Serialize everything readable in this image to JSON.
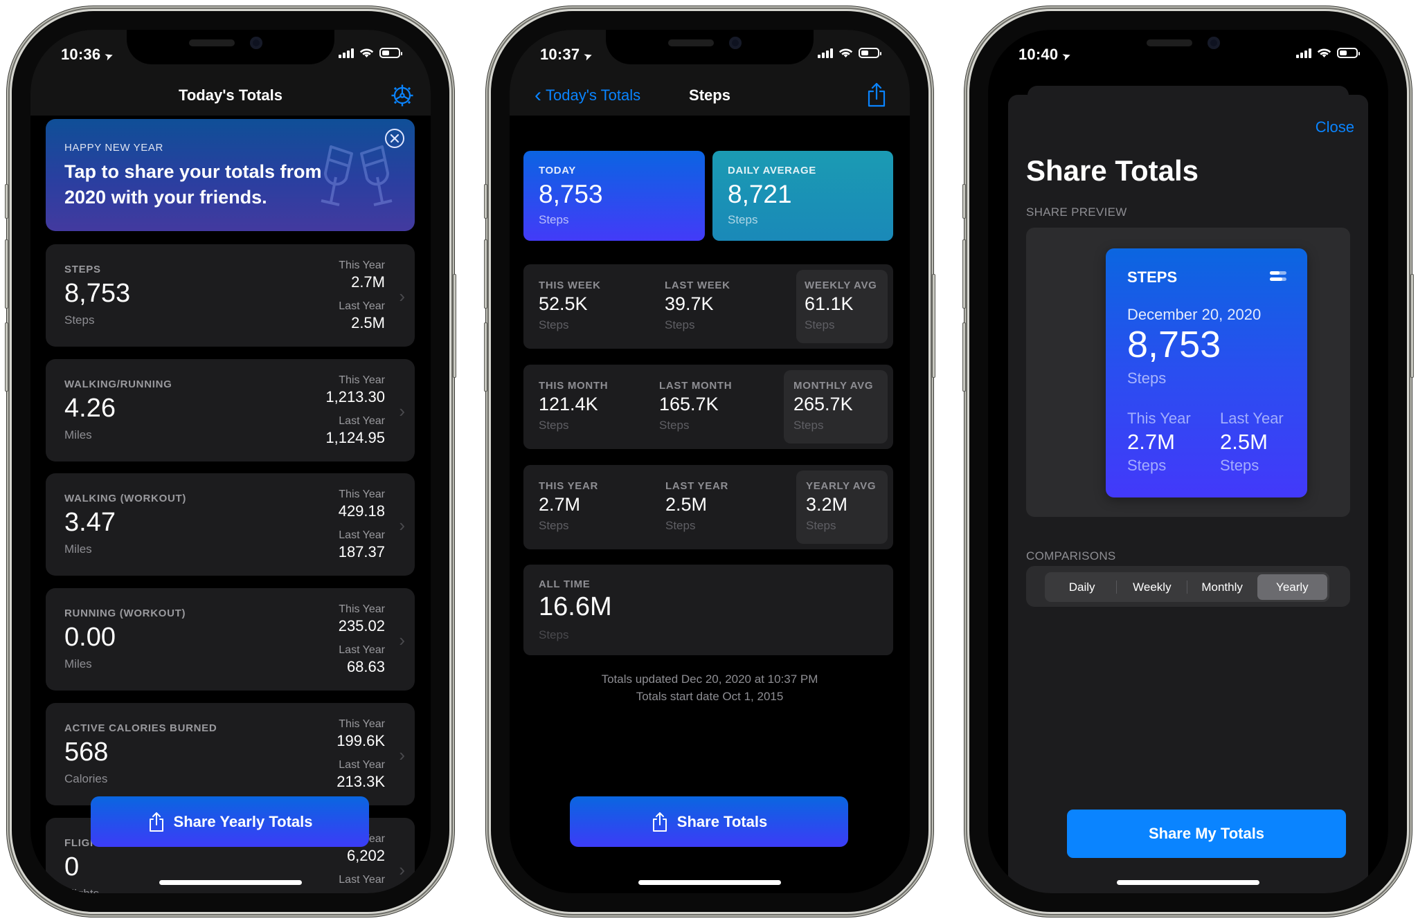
{
  "screens": [
    {
      "status": {
        "time": "10:36"
      },
      "nav": {
        "title": "Today's Totals",
        "settings_icon": "gear-icon"
      },
      "banner": {
        "kicker": "HAPPY NEW YEAR",
        "message": "Tap to share your totals from 2020 with your friends.",
        "close_icon": "close-circle-icon",
        "art_icon": "champagne-glasses-icon",
        "colors": {
          "top": "#0f4f97",
          "bottom": "#433a9f"
        }
      },
      "cards": [
        {
          "label": "STEPS",
          "value": "8,753",
          "unit": "Steps",
          "this_year_label": "This Year",
          "this_year": "2.7M",
          "last_year_label": "Last Year",
          "last_year": "2.5M"
        },
        {
          "label": "WALKING/RUNNING",
          "value": "4.26",
          "unit": "Miles",
          "this_year_label": "This Year",
          "this_year": "1,213.30",
          "last_year_label": "Last Year",
          "last_year": "1,124.95"
        },
        {
          "label": "WALKING (WORKOUT)",
          "value": "3.47",
          "unit": "Miles",
          "this_year_label": "This Year",
          "this_year": "429.18",
          "last_year_label": "Last Year",
          "last_year": "187.37"
        },
        {
          "label": "RUNNING (WORKOUT)",
          "value": "0.00",
          "unit": "Miles",
          "this_year_label": "This Year",
          "this_year": "235.02",
          "last_year_label": "Last Year",
          "last_year": "68.63"
        },
        {
          "label": "ACTIVE CALORIES BURNED",
          "value": "568",
          "unit": "Calories",
          "this_year_label": "This Year",
          "this_year": "199.6K",
          "last_year_label": "Last Year",
          "last_year": "213.3K"
        },
        {
          "label": "FLIGHTS",
          "value": "0",
          "unit": "Flights",
          "this_year_label": "This Year",
          "this_year": "6,202",
          "last_year_label": "Last Year",
          "last_year": ""
        }
      ],
      "share_button": {
        "label": "Share Yearly Totals",
        "icon": "share-icon"
      }
    },
    {
      "status": {
        "time": "10:37"
      },
      "nav": {
        "back_label": "Today's Totals",
        "title": "Steps",
        "share_icon": "share-icon"
      },
      "hero": [
        {
          "label": "TODAY",
          "value": "8,753",
          "unit": "Steps",
          "color": "#0b64e2"
        },
        {
          "label": "DAILY AVERAGE",
          "value": "8,721",
          "unit": "Steps",
          "color": "#1b9bb3"
        }
      ],
      "periods": [
        {
          "cells": [
            {
              "label": "THIS WEEK",
              "value": "52.5K",
              "unit": "Steps"
            },
            {
              "label": "LAST WEEK",
              "value": "39.7K",
              "unit": "Steps"
            },
            {
              "label": "WEEKLY AVG",
              "value": "61.1K",
              "unit": "Steps"
            }
          ]
        },
        {
          "cells": [
            {
              "label": "THIS MONTH",
              "value": "121.4K",
              "unit": "Steps"
            },
            {
              "label": "LAST MONTH",
              "value": "165.7K",
              "unit": "Steps"
            },
            {
              "label": "MONTHLY AVG",
              "value": "265.7K",
              "unit": "Steps"
            }
          ]
        },
        {
          "cells": [
            {
              "label": "THIS YEAR",
              "value": "2.7M",
              "unit": "Steps"
            },
            {
              "label": "LAST YEAR",
              "value": "2.5M",
              "unit": "Steps"
            },
            {
              "label": "YEARLY AVG",
              "value": "3.2M",
              "unit": "Steps"
            }
          ]
        }
      ],
      "all_time": {
        "label": "ALL TIME",
        "value": "16.6M",
        "unit": "Steps"
      },
      "footer": {
        "updated": "Totals updated Dec 20, 2020 at 10:37 PM",
        "start": "Totals start date Oct 1, 2015"
      },
      "share_button": {
        "label": "Share Totals",
        "icon": "share-icon"
      }
    },
    {
      "status": {
        "time": "10:40"
      },
      "close_label": "Close",
      "title": "Share Totals",
      "preview_label": "SHARE PREVIEW",
      "preview": {
        "title": "STEPS",
        "toggle_icon": "toggle-icon",
        "date": "December 20, 2020",
        "value": "8,753",
        "unit": "Steps",
        "this_year_label": "This Year",
        "this_year": "2.7M",
        "this_year_unit": "Steps",
        "last_year_label": "Last Year",
        "last_year": "2.5M",
        "last_year_unit": "Steps"
      },
      "comparisons_label": "COMPARISONS",
      "comparisons": {
        "options": [
          "Daily",
          "Weekly",
          "Monthly",
          "Yearly"
        ],
        "selected": "Yearly"
      },
      "share_button": {
        "label": "Share My Totals",
        "color": "#0a84ff"
      }
    }
  ]
}
